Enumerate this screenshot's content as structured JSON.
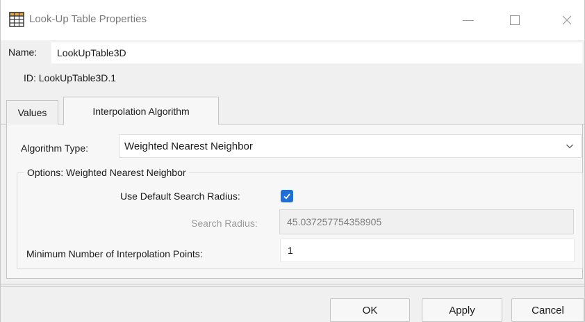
{
  "window": {
    "title": "Look-Up Table Properties"
  },
  "name_row": {
    "label": "Name:",
    "value": "LookUpTable3D"
  },
  "id_row": {
    "text": "ID: LookUpTable3D.1"
  },
  "tabs": [
    {
      "label": "Values",
      "active": false
    },
    {
      "label": "Interpolation Algorithm",
      "active": true
    }
  ],
  "algorithm": {
    "label": "Algorithm Type:",
    "selected": "Weighted Nearest Neighbor"
  },
  "options_group": {
    "legend": "Options: Weighted Nearest Neighbor",
    "use_default_radius_label": "Use Default Search Radius:",
    "use_default_radius_checked": true,
    "search_radius_label": "Search Radius:",
    "search_radius_value": "45.037257754358905",
    "min_points_label": "Minimum Number of Interpolation Points:",
    "min_points_value": "1"
  },
  "buttons": {
    "ok": "OK",
    "apply": "Apply",
    "cancel": "Cancel"
  },
  "colors": {
    "checkbox_accent": "#1e6fd9",
    "window_bg": "#f0f0f0",
    "panel_bg": "#f7f7f7"
  },
  "icons": {
    "app": "table-grid-icon",
    "minimize": "minimize-icon",
    "maximize": "maximize-icon",
    "close": "close-icon",
    "dropdown": "chevron-down-icon",
    "checkbox": "checkmark-icon"
  }
}
